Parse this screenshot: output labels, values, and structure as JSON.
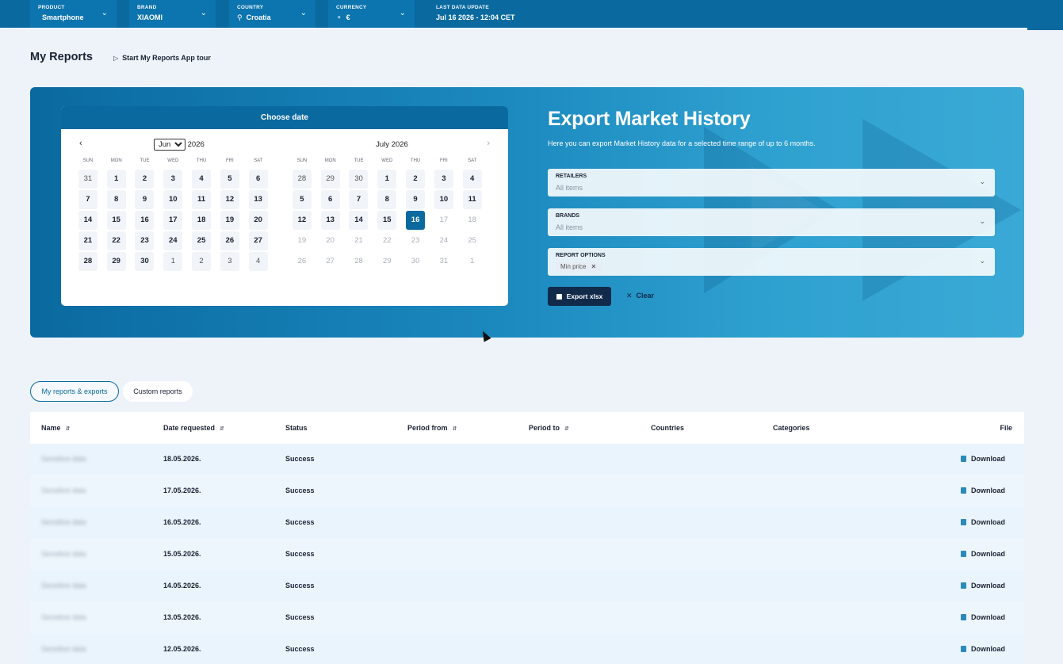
{
  "topbar": {
    "product": {
      "label": "PRODUCT",
      "value": "Smartphone"
    },
    "brand": {
      "label": "BRAND",
      "value": "XIAOMI"
    },
    "country": {
      "label": "COUNTRY",
      "value": "Croatia"
    },
    "currency": {
      "label": "CURRENCY",
      "value": "€"
    },
    "last_update": {
      "label": "LAST DATA UPDATE",
      "value": "Jul 16 2026 - 12:04 CET"
    }
  },
  "header": {
    "title": "My Reports",
    "tour": "Start My Reports App tour"
  },
  "calendar": {
    "title": "Choose date",
    "left_month": "Jun",
    "left_year": "2026",
    "right_title": "July 2026",
    "weekdays": [
      "SUN",
      "MON",
      "TUE",
      "WED",
      "THU",
      "FRI",
      "SAT"
    ],
    "left_weeks": [
      [
        "31",
        "1",
        "2",
        "3",
        "4",
        "5",
        "6"
      ],
      [
        "7",
        "8",
        "9",
        "10",
        "11",
        "12",
        "13"
      ],
      [
        "14",
        "15",
        "16",
        "17",
        "18",
        "19",
        "20"
      ],
      [
        "21",
        "22",
        "23",
        "24",
        "25",
        "26",
        "27"
      ],
      [
        "28",
        "29",
        "30",
        "1",
        "2",
        "3",
        "4"
      ]
    ],
    "right_weeks": [
      [
        "28",
        "29",
        "30",
        "1",
        "2",
        "3",
        "4"
      ],
      [
        "5",
        "6",
        "7",
        "8",
        "9",
        "10",
        "11"
      ],
      [
        "12",
        "13",
        "14",
        "15",
        "16",
        "17",
        "18"
      ],
      [
        "19",
        "20",
        "21",
        "22",
        "23",
        "24",
        "25"
      ],
      [
        "26",
        "27",
        "28",
        "29",
        "30",
        "31",
        "1"
      ]
    ],
    "selected": "16"
  },
  "export": {
    "title": "Export Market History",
    "subtitle": "Here you can export Market History data for a selected time range of up to 6 months.",
    "retailers": {
      "label": "RETAILERS",
      "value": "All items"
    },
    "brands": {
      "label": "BRANDS",
      "value": "All items"
    },
    "report_options": {
      "label": "REPORT OPTIONS",
      "chip": "Min price"
    },
    "export_button": "Export xlsx",
    "clear_button": "Clear"
  },
  "tabs": [
    "My reports & exports",
    "Custom reports"
  ],
  "table": {
    "columns": [
      "Name",
      "Date requested",
      "Status",
      "Period from",
      "Period to",
      "Countries",
      "Categories",
      "File"
    ],
    "rows": [
      {
        "name": "Sensitive data",
        "date": "18.05.2026.",
        "status": "Success",
        "file": "Download"
      },
      {
        "name": "Sensitive data",
        "date": "17.05.2026.",
        "status": "Success",
        "file": "Download"
      },
      {
        "name": "Sensitive data",
        "date": "16.05.2026.",
        "status": "Success",
        "file": "Download"
      },
      {
        "name": "Sensitive data",
        "date": "15.05.2026.",
        "status": "Success",
        "file": "Download"
      },
      {
        "name": "Sensitive data",
        "date": "14.05.2026.",
        "status": "Success",
        "file": "Download"
      },
      {
        "name": "Sensitive data",
        "date": "13.05.2026.",
        "status": "Success",
        "file": "Download"
      },
      {
        "name": "Sensitive data",
        "date": "12.05.2026.",
        "status": "Success",
        "file": "Download"
      }
    ]
  }
}
